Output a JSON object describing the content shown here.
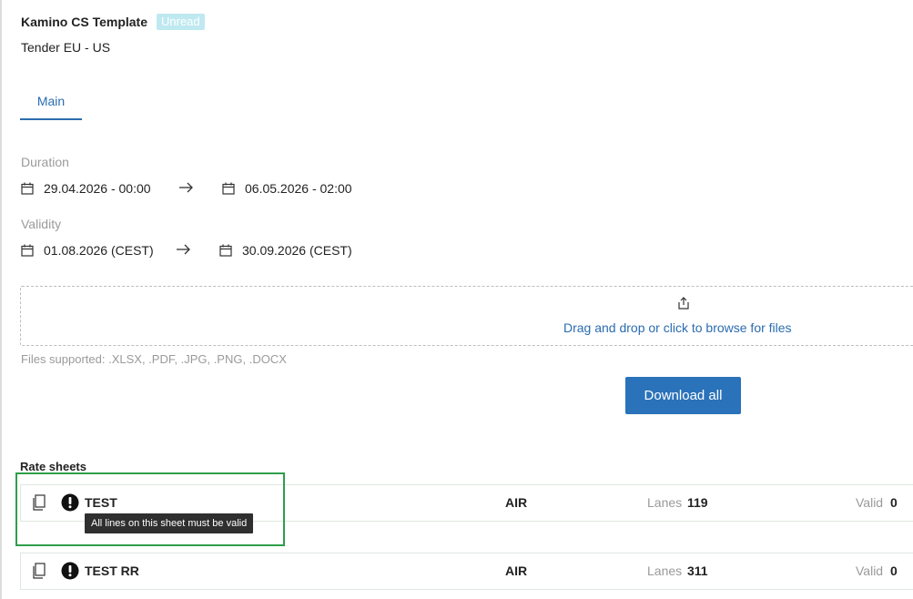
{
  "header": {
    "title": "Kamino CS Template",
    "badge": "Unread",
    "subtitle": "Tender EU - US"
  },
  "tabs": [
    {
      "label": "Main",
      "active": true
    }
  ],
  "duration": {
    "label": "Duration",
    "start": "29.04.2026 - 00:00",
    "end": "06.05.2026 - 02:00"
  },
  "validity": {
    "label": "Validity",
    "start": "01.08.2026 (CEST)",
    "end": "30.09.2026 (CEST)"
  },
  "upload": {
    "drop_text": "Drag and drop or click to browse for files",
    "files_supported": "Files supported: .XLSX, .PDF, .JPG, .PNG, .DOCX"
  },
  "download_all_label": "Download all",
  "rate_sheets": {
    "title": "Rate sheets",
    "lanes_label": "Lanes",
    "valid_label": "Valid",
    "items": [
      {
        "name": "TEST",
        "mode": "AIR",
        "lanes": "119",
        "valid": "0"
      },
      {
        "name": "TEST RR",
        "mode": "AIR",
        "lanes": "311",
        "valid": "0"
      }
    ],
    "tooltip": "All lines on this sheet must be valid"
  },
  "colors": {
    "accent": "#2a72ba",
    "badge_bg": "#bfe9f0",
    "highlight": "#2e9e4a",
    "tooltip_bg": "#2f2f2f"
  }
}
